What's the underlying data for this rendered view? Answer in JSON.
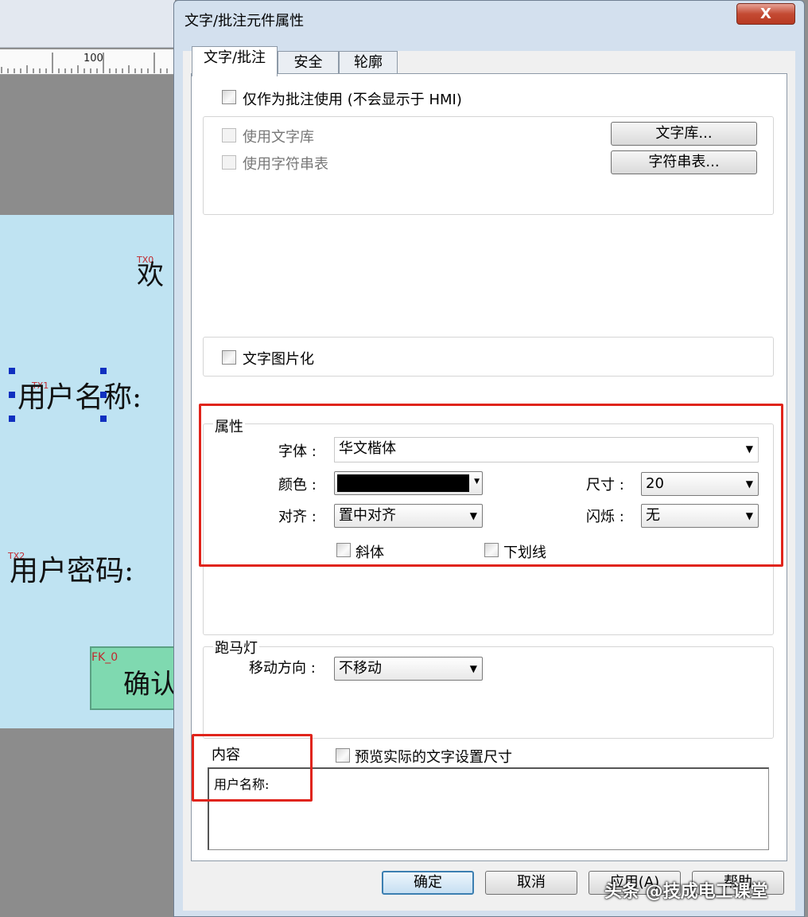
{
  "background": {
    "ruler_label": "100",
    "canvas_texts": [
      {
        "id": "TX0",
        "text": "欢"
      },
      {
        "id": "TX1",
        "text": "用户名称:"
      },
      {
        "id": "TX2",
        "text": "用户密码:"
      }
    ],
    "button": {
      "tag": "FK_0",
      "text": "确认"
    }
  },
  "dialog": {
    "title": "文字/批注元件属性",
    "close_label": "X",
    "tabs": [
      {
        "label": "文字/批注",
        "active": true
      },
      {
        "label": "安全",
        "active": false
      },
      {
        "label": "轮廓",
        "active": false
      }
    ],
    "annotation_only": {
      "label": "仅作为批注使用 (不会显示于 HMI)",
      "checked": false
    },
    "library": {
      "use_text_library": "使用文字库",
      "use_string_table": "使用字符串表",
      "text_library_button": "文字库...",
      "string_table_button": "字符串表..."
    },
    "text_to_image": {
      "label": "文字图片化",
      "checked": false
    },
    "properties": {
      "group_title": "属性",
      "font_label": "字体 :",
      "font_value": "华文楷体",
      "color_label": "颜色 :",
      "color_value": "#000000",
      "size_label": "尺寸 :",
      "size_value": "20",
      "align_label": "对齐 :",
      "align_value": "置中对齐",
      "blink_label": "闪烁 :",
      "blink_value": "无",
      "italic_label": "斜体",
      "underline_label": "下划线"
    },
    "marquee": {
      "group_title": "跑马灯",
      "direction_label": "移动方向 :",
      "direction_value": "不移动"
    },
    "content": {
      "group_title": "内容",
      "preview_label": "预览实际的文字设置尺寸",
      "text": "用户名称:"
    },
    "footer": {
      "ok": "确定",
      "cancel": "取消",
      "apply": "应用(A)",
      "help": "帮助"
    }
  },
  "watermark": "头条 @技成电工课堂",
  "colors": {
    "highlight": "#e0241b",
    "dialog_frame": "#d3e0ee",
    "canvas": "#bfe3f2"
  }
}
